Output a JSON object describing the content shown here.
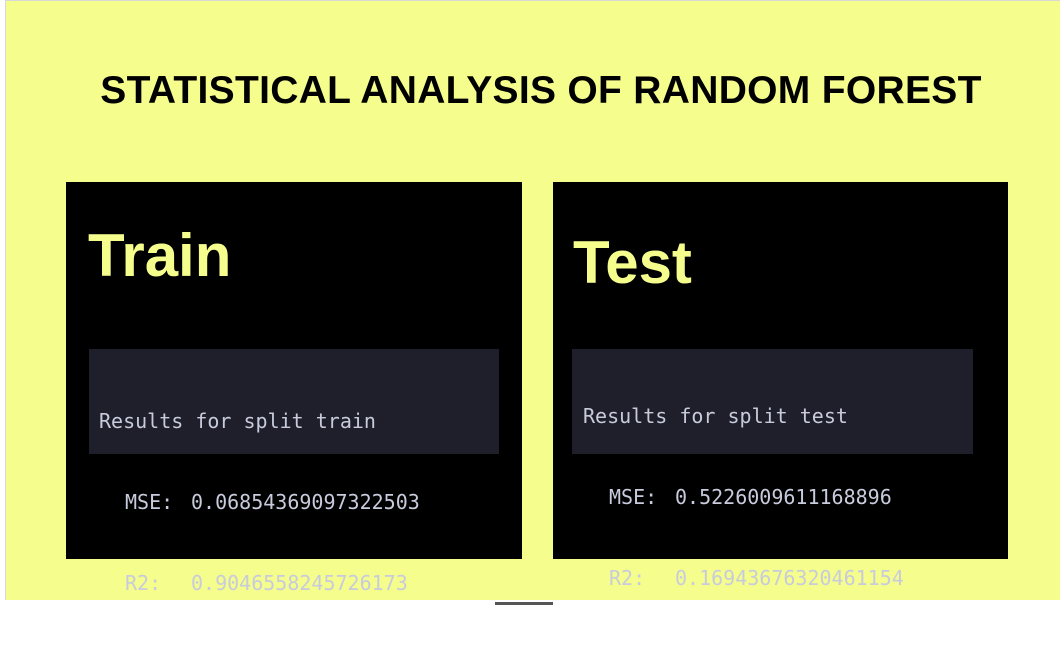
{
  "slide": {
    "title": "STATISTICAL ANALYSIS OF RANDOM FOREST",
    "background_color": "#f5fd8d",
    "accent_color": "#f5fd8d"
  },
  "train": {
    "heading": "Train",
    "terminal": {
      "header": "Results for split train",
      "mse_label": "MSE:",
      "mse_value": "0.06854369097322503",
      "r2_label": "R2:",
      "r2_value": "0.9046558245726173"
    }
  },
  "test": {
    "heading": "Test",
    "terminal": {
      "header": "Results for split test",
      "mse_label": "MSE:",
      "mse_value": "0.5226009611168896",
      "r2_label": "R2:",
      "r2_value": "0.16943676320461154"
    }
  }
}
